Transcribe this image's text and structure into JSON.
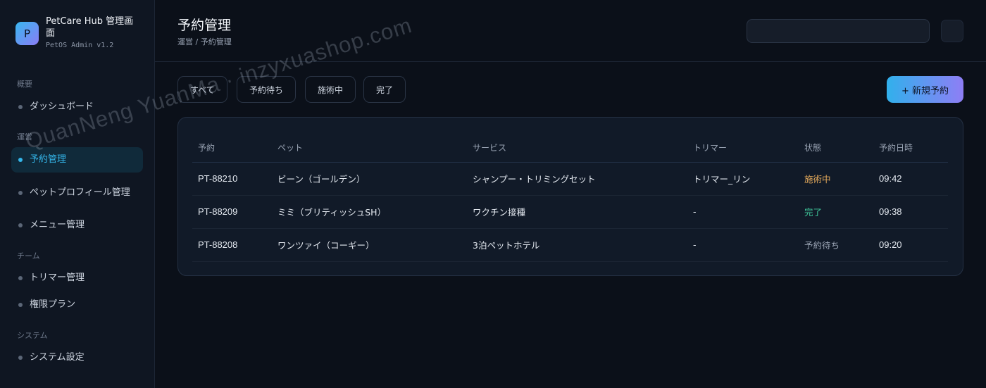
{
  "brand": {
    "logo_letter": "P",
    "title": "PetCare Hub 管理画面",
    "subtitle": "PetOS Admin v1.2"
  },
  "sidebar": {
    "sections": [
      {
        "label": "概要",
        "items": [
          {
            "label": "ダッシュボード"
          }
        ]
      },
      {
        "label": "運営",
        "items": [
          {
            "label": "予約管理",
            "active": true
          },
          {
            "label": "ペットプロフィール管理"
          },
          {
            "label": "メニュー管理"
          }
        ]
      },
      {
        "label": "チーム",
        "items": [
          {
            "label": "トリマー管理"
          },
          {
            "label": "権限プラン"
          }
        ]
      },
      {
        "label": "システム",
        "items": [
          {
            "label": "システム設定"
          }
        ]
      }
    ]
  },
  "header": {
    "title": "予約管理",
    "breadcrumb": "運営 / 予約管理",
    "search_value": ""
  },
  "filters": [
    "すべて",
    "予約待ち",
    "施術中",
    "完了"
  ],
  "new_button": "+ 新規予約",
  "table": {
    "columns": [
      "予約",
      "ペット",
      "サービス",
      "トリマー",
      "状態",
      "予約日時"
    ],
    "rows": [
      {
        "id": "PT-88210",
        "pet": "ビーン（ゴールデン）",
        "service": "シャンプー・トリミングセット",
        "trimmer": "トリマー_リン",
        "status": "施術中",
        "time": "09:42"
      },
      {
        "id": "PT-88209",
        "pet": "ミミ（ブリティッシュSH）",
        "service": "ワクチン接種",
        "trimmer": "-",
        "status": "完了",
        "time": "09:38"
      },
      {
        "id": "PT-88208",
        "pet": "ワンツァイ（コーギー）",
        "service": "3泊ペットホテル",
        "trimmer": "-",
        "status": "予約待ち",
        "time": "09:20"
      }
    ]
  },
  "status_colors": {
    "施術中": "#e0a75a",
    "完了": "#3fc79a",
    "予約待ち": "#9aa4b4"
  },
  "accent_color": "#34b6ea",
  "watermark": "QuanNeng YuanMa · inzyxuashop.com"
}
